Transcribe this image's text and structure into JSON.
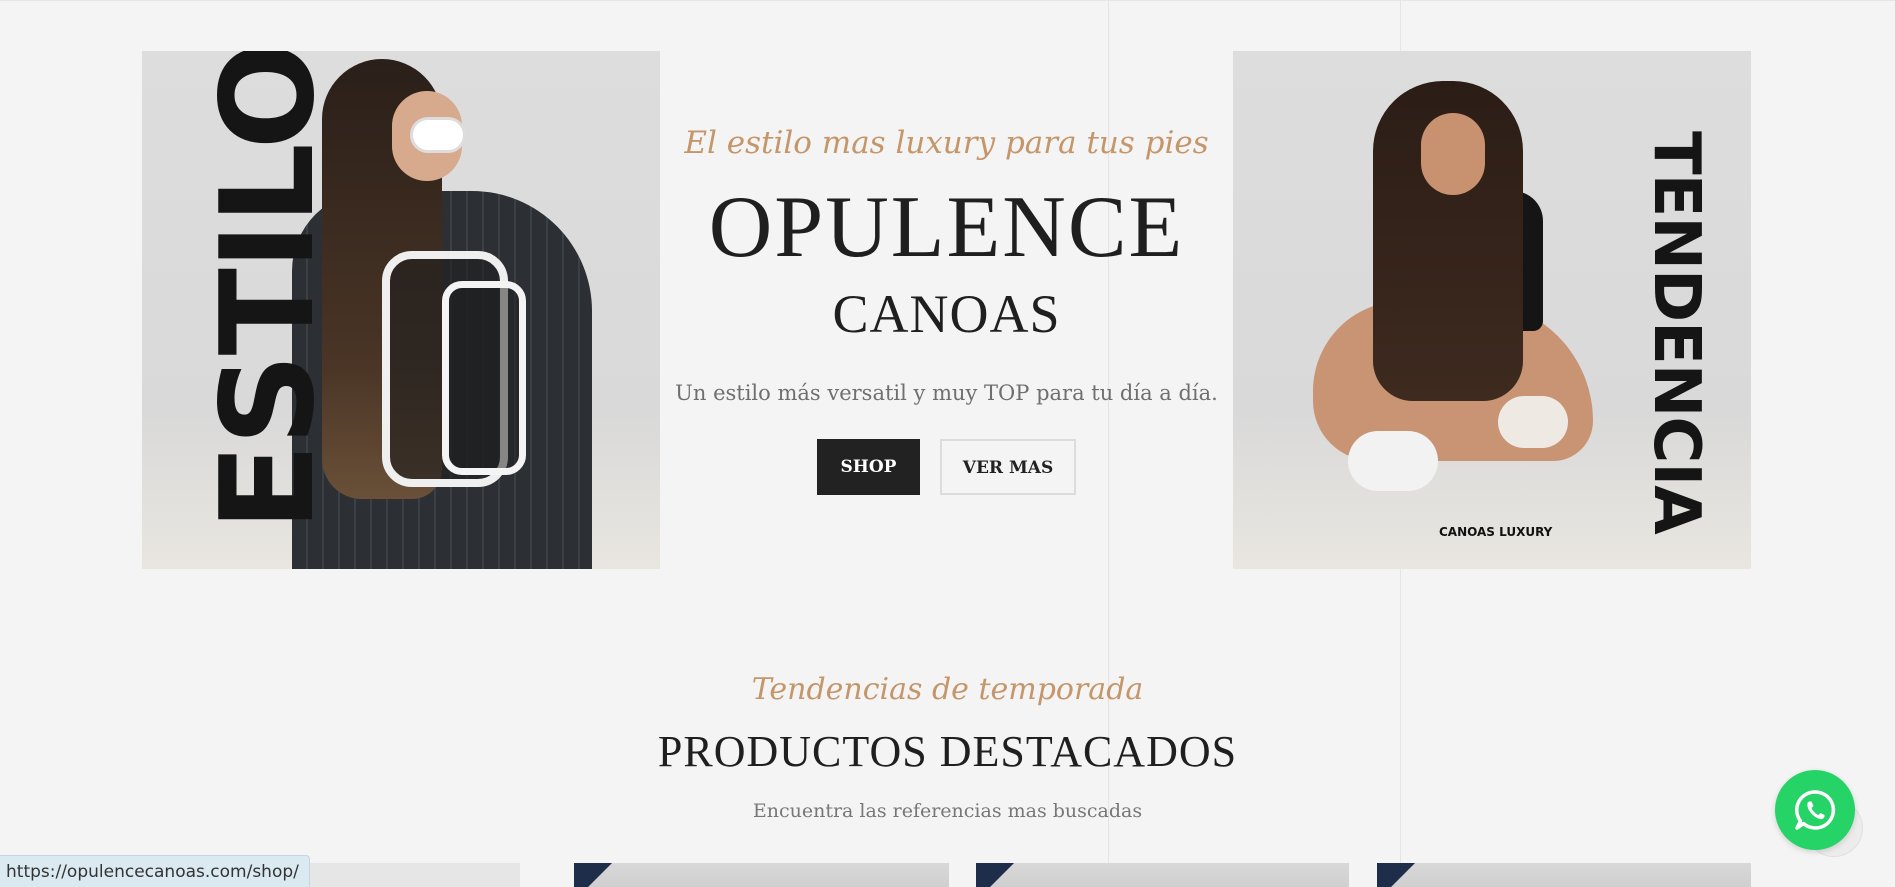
{
  "hero": {
    "left_image": {
      "overlay_text": "ESTILO"
    },
    "right_image": {
      "overlay_text": "TENDENCIA",
      "brand_label": "CANOAS LUXURY"
    },
    "tagline": "El estilo mas luxury para tus pies",
    "title": "OPULENCE",
    "subtitle": "CANOAS",
    "description": "Un estilo más versatil  y muy TOP para tu día a día.",
    "buttons": {
      "shop": "SHOP",
      "more": "VER MAS"
    }
  },
  "featured": {
    "tagline": "Tendencias de temporada",
    "title": "PRODUCTOS DESTACADOS",
    "description": "Encuentra las referencias mas buscadas",
    "product_count_visible": 4
  },
  "whatsapp": {
    "icon": "whatsapp-icon",
    "color": "#25d366"
  },
  "status_bar": {
    "url": "https://opulencecanoas.com/shop/"
  },
  "colors": {
    "accent": "#c4966a",
    "dark": "#222222",
    "background": "#f4f4f4"
  }
}
